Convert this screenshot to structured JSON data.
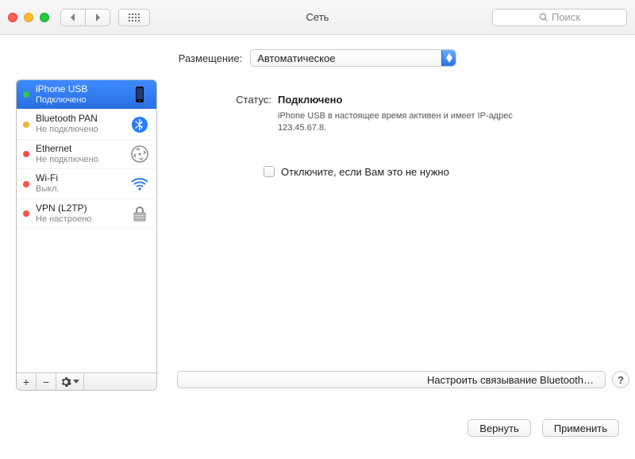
{
  "window": {
    "title": "Сеть"
  },
  "toolbar": {
    "search_placeholder": "Поиск"
  },
  "location": {
    "label": "Размещение:",
    "value": "Автоматическое"
  },
  "sidebar": {
    "services": [
      {
        "name": "iPhone USB",
        "sub": "Подключено",
        "status": "green",
        "icon": "iphone"
      },
      {
        "name": "Bluetooth PAN",
        "sub": "Не подключено",
        "status": "orange",
        "icon": "bluetooth"
      },
      {
        "name": "Ethernet",
        "sub": "Не подключено",
        "status": "red",
        "icon": "ethernet"
      },
      {
        "name": "Wi-Fi",
        "sub": "Выкл.",
        "status": "red",
        "icon": "wifi"
      },
      {
        "name": "VPN (L2TP)",
        "sub": "Не настроено",
        "status": "red",
        "icon": "vpn"
      }
    ],
    "selected": 0
  },
  "detail": {
    "status_label": "Статус:",
    "status_value": "Подключено",
    "status_desc": "iPhone USB  в настоящее время активен и имеет IP-адрес 123.45.67.8.",
    "checkbox_label": "Отключите, если Вам это не нужно",
    "additional_btn": "Настроить связывание Bluetooth…"
  },
  "buttons": {
    "revert": "Вернуть",
    "apply": "Применить",
    "help": "?"
  }
}
